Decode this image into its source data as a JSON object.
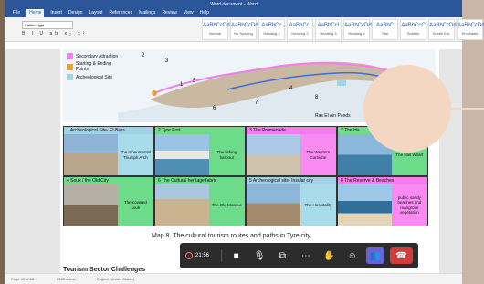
{
  "window": {
    "title": "Word document - Word"
  },
  "ribbon": {
    "tabs": [
      "File",
      "Home",
      "Insert",
      "Design",
      "Layout",
      "References",
      "Mailings",
      "Review",
      "View",
      "Help"
    ],
    "active_tab": "Home",
    "font_name": "Calibri Light",
    "format_glyphs": "B I U ab x₂ x²",
    "styles": [
      {
        "preview": "AaBbCcDd",
        "name": "Normal"
      },
      {
        "preview": "AaBbCcDd",
        "name": "No Spacing"
      },
      {
        "preview": "AaBbCc",
        "name": "Heading 1"
      },
      {
        "preview": "AaBbCcI",
        "name": "Heading 2"
      },
      {
        "preview": "AaBbCcI",
        "name": "Heading 3"
      },
      {
        "preview": "AaBbCcDd",
        "name": "Heading 4"
      },
      {
        "preview": "AaBbC",
        "name": "Title"
      },
      {
        "preview": "AaBbCcC",
        "name": "Subtitle"
      },
      {
        "preview": "AaBbCcDd",
        "name": "Subtle Em."
      },
      {
        "preview": "AaBbCcDd",
        "name": "Emphasis"
      }
    ]
  },
  "figure": {
    "legend": [
      {
        "label": "Secondary Attraction",
        "color": "#f57bf0"
      },
      {
        "label": "Starting & Ending Points",
        "color": "#f0a030"
      },
      {
        "label": "Archeological Site",
        "color": "#9fd4e6"
      }
    ],
    "map_markers": [
      "1",
      "2",
      "3",
      "4",
      "5",
      "6",
      "7",
      "8"
    ],
    "map_label": "Ras El Ain Ponds",
    "cells": [
      {
        "num": "1",
        "title": "Archeological Site- El Bass",
        "desc": "The monumental Triumph Arch",
        "tone": "blue"
      },
      {
        "num": "2",
        "title": "Tyre Port",
        "desc": "The fishing harbour",
        "tone": "green"
      },
      {
        "num": "3",
        "title": "The Promenade",
        "desc": "The Western Corniche",
        "tone": "pink"
      },
      {
        "num": "7",
        "title": "The Ha...",
        "desc": "The Hall Wharf",
        "tone": "green"
      },
      {
        "num": "4",
        "title": "Souk / the Old City",
        "desc": "The covered souk",
        "tone": "green"
      },
      {
        "num": "6",
        "title": "The Cultural heritage fabric",
        "desc": "The Old Mosque",
        "tone": "green"
      },
      {
        "num": "5",
        "title": "Archeological site- Insular city",
        "desc": "The Hospitality",
        "tone": "blue"
      },
      {
        "num": "8",
        "title": "The Reserve & Beaches",
        "desc": "public sandy beaches and mangrove vegetation",
        "tone": "pink"
      }
    ]
  },
  "document": {
    "caption": "Map 8. The cultural tourism routes and paths in Tyre city.",
    "next_heading": "Tourism Sector Challenges"
  },
  "meeting": {
    "timer": "21:56"
  },
  "statusbar": {
    "page": "Page 40 of 68",
    "words": "8345 words",
    "language": "English (United States)"
  }
}
